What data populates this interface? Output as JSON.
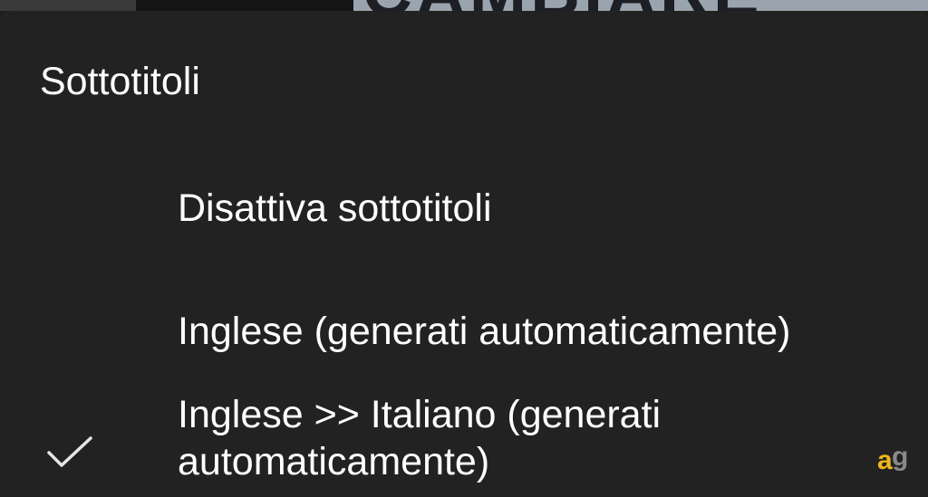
{
  "background_video": {
    "partial_text": "CAMBIARE"
  },
  "sheet": {
    "title": "Sottotitoli",
    "options": [
      {
        "label": "Disattiva sottotitoli",
        "selected": false
      },
      {
        "label": "Inglese (generati automaticamente)",
        "selected": false
      },
      {
        "label": "Inglese >> Italiano (generati automaticamente)",
        "selected": true
      }
    ]
  },
  "watermark": {
    "letters": "ag",
    "icon": "ag-logo-icon",
    "colors": {
      "a": "#f2b51c",
      "g": "#8a8a8a"
    }
  },
  "colors": {
    "sheet_background": "#222222",
    "text": "#ffffff",
    "check": "#e6e6e6"
  }
}
